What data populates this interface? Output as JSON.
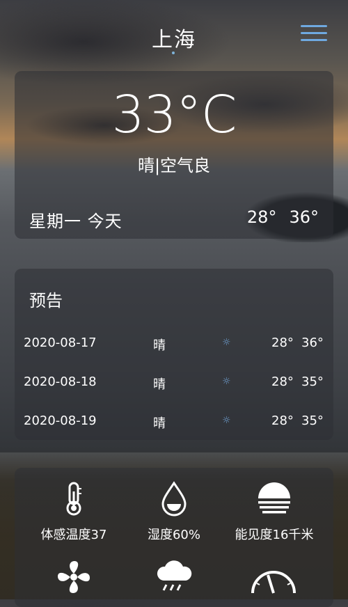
{
  "city": "上海",
  "current": {
    "temperature": "33°C",
    "condition": "晴|空气良",
    "day_label": "星期一  今天",
    "low": "28°",
    "high": "36°"
  },
  "forecast": {
    "title": "预告",
    "rows": [
      {
        "date": "2020-08-17",
        "weather": "晴",
        "icon": "sun-icon",
        "low": "28°",
        "high": "36°"
      },
      {
        "date": "2020-08-18",
        "weather": "晴",
        "icon": "sun-icon",
        "low": "28°",
        "high": "35°"
      },
      {
        "date": "2020-08-19",
        "weather": "晴",
        "icon": "sun-icon",
        "low": "28°",
        "high": "35°"
      }
    ]
  },
  "details": {
    "feels_like": "体感温度37",
    "humidity": "湿度60%",
    "visibility": "能见度16千米"
  },
  "icons": {
    "feels_like": "thermometer-icon",
    "humidity": "water-drop-icon",
    "visibility": "fog-sun-icon",
    "wind": "fan-icon",
    "precipitation": "rain-cloud-icon",
    "pressure": "gauge-icon"
  },
  "colors": {
    "accent": "#6fa9e0",
    "card_bg": "rgba(45,47,52,0.55)"
  }
}
